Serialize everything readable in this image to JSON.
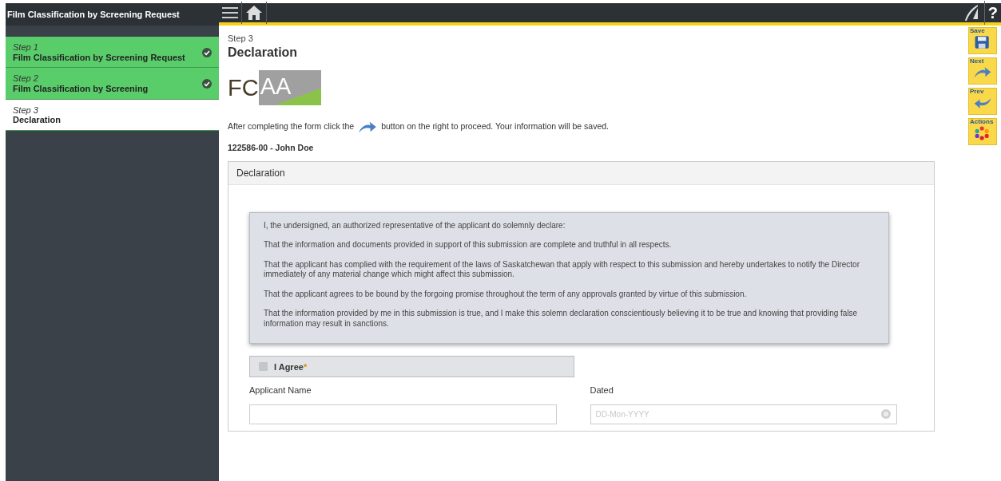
{
  "sidebar": {
    "title": "Film Classification by Screening Request",
    "steps": [
      {
        "step": "Step 1",
        "label": "Film Classification by Screening Request",
        "completed": true,
        "selected": false
      },
      {
        "step": "Step 2",
        "label": "Film Classification by Screening",
        "completed": true,
        "selected": false
      },
      {
        "step": "Step 3",
        "label": "Declaration",
        "completed": false,
        "selected": true
      }
    ]
  },
  "toolbar": {
    "help": "?"
  },
  "page": {
    "step": "Step 3",
    "title": "Declaration",
    "logo": {
      "left": "FC",
      "right": "AA"
    },
    "instruction": {
      "before": "After completing the form click the",
      "after": "button on the right to proceed. Your information will be saved."
    },
    "applicant": "122586-00 - John Doe",
    "panel": {
      "title": "Declaration",
      "statements": [
        "I, the undersigned, an authorized representative of the applicant do solemnly declare:",
        "That the information and documents provided in support of this submission are complete and truthful in all respects.",
        "That the applicant has complied with the requirement of the laws of Saskatchewan that apply with respect to this submission and hereby undertakes to notify the Director immediately of any material change which might affect this submission.",
        "That the applicant agrees to be bound by the forgoing promise throughout the term of any approvals granted by virtue of this submission.",
        "That the information provided by me in this submission is true, and I make this solemn declaration conscientiously believing it to be true and knowing that providing false information may result in sanctions."
      ],
      "agree": {
        "label": "I Agree",
        "required_mark": "*",
        "checked": false
      },
      "fields": [
        {
          "label": "Applicant Name",
          "kind": "text"
        },
        {
          "label": "Dated",
          "placeholder": "DD-Mon-YYYY",
          "kind": "date"
        }
      ]
    }
  },
  "actions": [
    {
      "label": "Save",
      "kind": "save"
    },
    {
      "label": "Next",
      "kind": "next"
    },
    {
      "label": "Prev",
      "kind": "prev"
    },
    {
      "label": "Actions",
      "kind": "actions"
    }
  ]
}
